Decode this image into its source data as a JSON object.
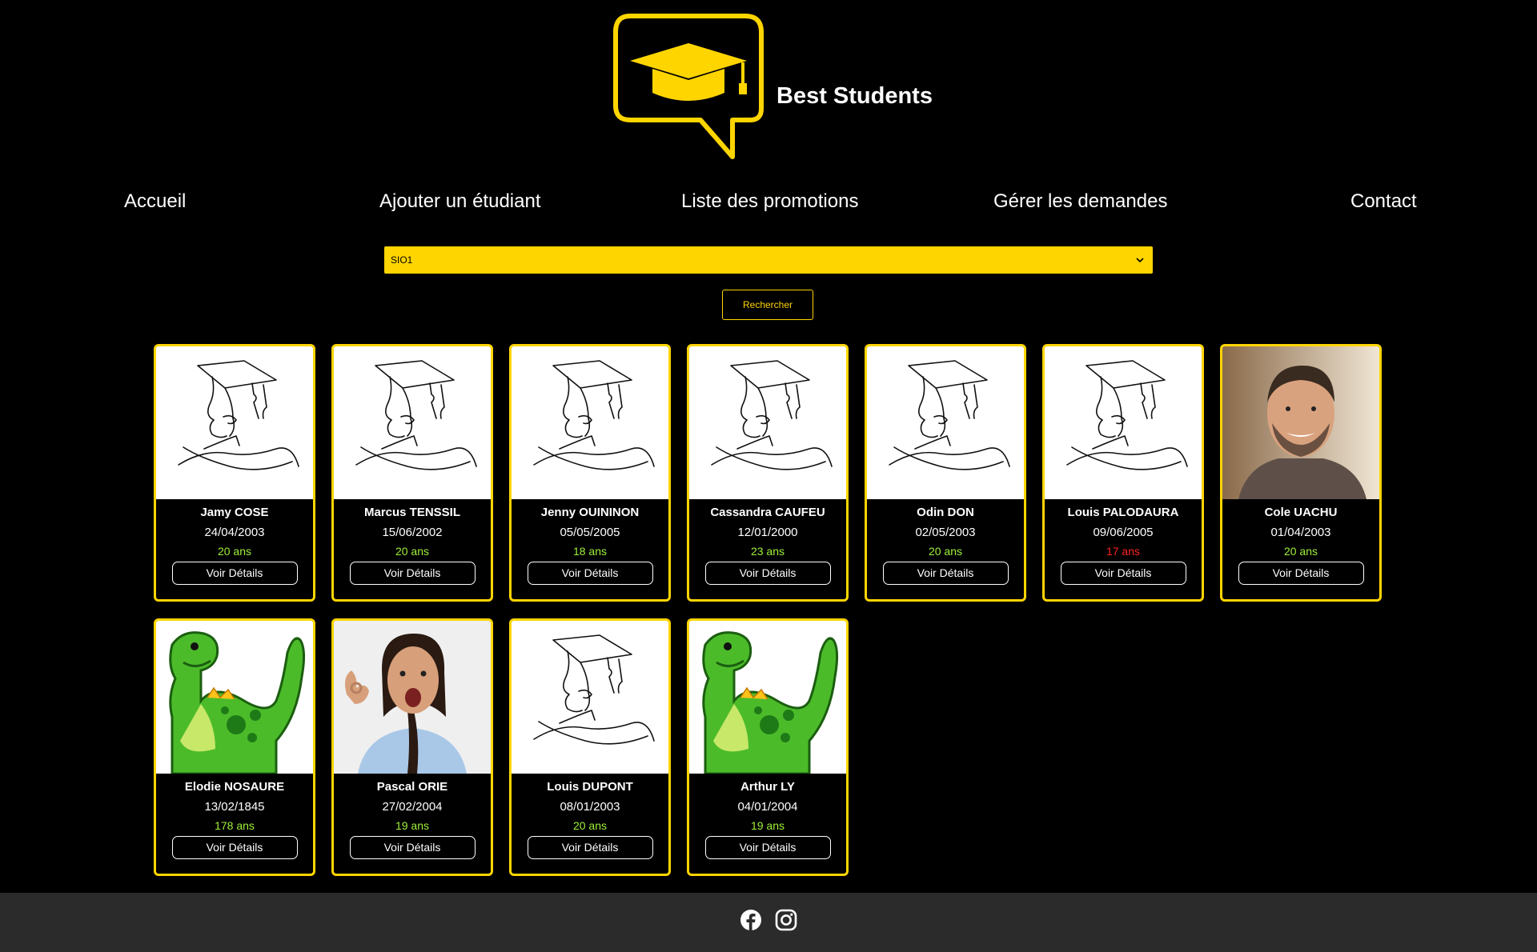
{
  "brand": {
    "name": "Best Students",
    "accent": "#ffd500"
  },
  "nav": [
    {
      "label": "Accueil"
    },
    {
      "label": "Ajouter un étudiant"
    },
    {
      "label": "Liste des promotions"
    },
    {
      "label": "Gérer les demandes"
    },
    {
      "label": "Contact"
    }
  ],
  "filter": {
    "selected": "SIO1",
    "search_label": "Rechercher"
  },
  "students": [
    {
      "name": "Jamy COSE",
      "dob": "24/04/2003",
      "age": "20 ans",
      "photo": "graduate-drawing",
      "button": "Voir Détails"
    },
    {
      "name": "Marcus TENSSIL",
      "dob": "15/06/2002",
      "age": "20 ans",
      "photo": "graduate-drawing",
      "button": "Voir Détails"
    },
    {
      "name": "Jenny OUININON",
      "dob": "05/05/2005",
      "age": "18 ans",
      "photo": "graduate-drawing",
      "button": "Voir Détails"
    },
    {
      "name": "Cassandra CAUFEU",
      "dob": "12/01/2000",
      "age": "23 ans",
      "photo": "graduate-drawing",
      "button": "Voir Détails"
    },
    {
      "name": "Odin DON",
      "dob": "02/05/2003",
      "age": "20 ans",
      "photo": "graduate-drawing",
      "button": "Voir Détails"
    },
    {
      "name": "Louis PALODAURA",
      "dob": "09/06/2005",
      "age": "17 ans",
      "minor": true,
      "photo": "graduate-drawing",
      "button": "Voir Détails"
    },
    {
      "name": "Cole UACHU",
      "dob": "01/04/2003",
      "age": "20 ans",
      "photo": "man-portrait",
      "button": "Voir Détails"
    },
    {
      "name": "Elodie NOSAURE",
      "dob": "13/02/1845",
      "age": "178 ans",
      "photo": "dinosaur",
      "button": "Voir Détails"
    },
    {
      "name": "Pascal ORIE",
      "dob": "27/02/2004",
      "age": "19 ans",
      "photo": "woman-portrait",
      "button": "Voir Détails"
    },
    {
      "name": "Louis DUPONT",
      "dob": "08/01/2003",
      "age": "20 ans",
      "photo": "graduate-drawing",
      "button": "Voir Détails"
    },
    {
      "name": "Arthur LY",
      "dob": "04/01/2004",
      "age": "19 ans",
      "photo": "dinosaur",
      "button": "Voir Détails"
    }
  ],
  "footer": {
    "icons": [
      "facebook-icon",
      "instagram-icon"
    ]
  }
}
